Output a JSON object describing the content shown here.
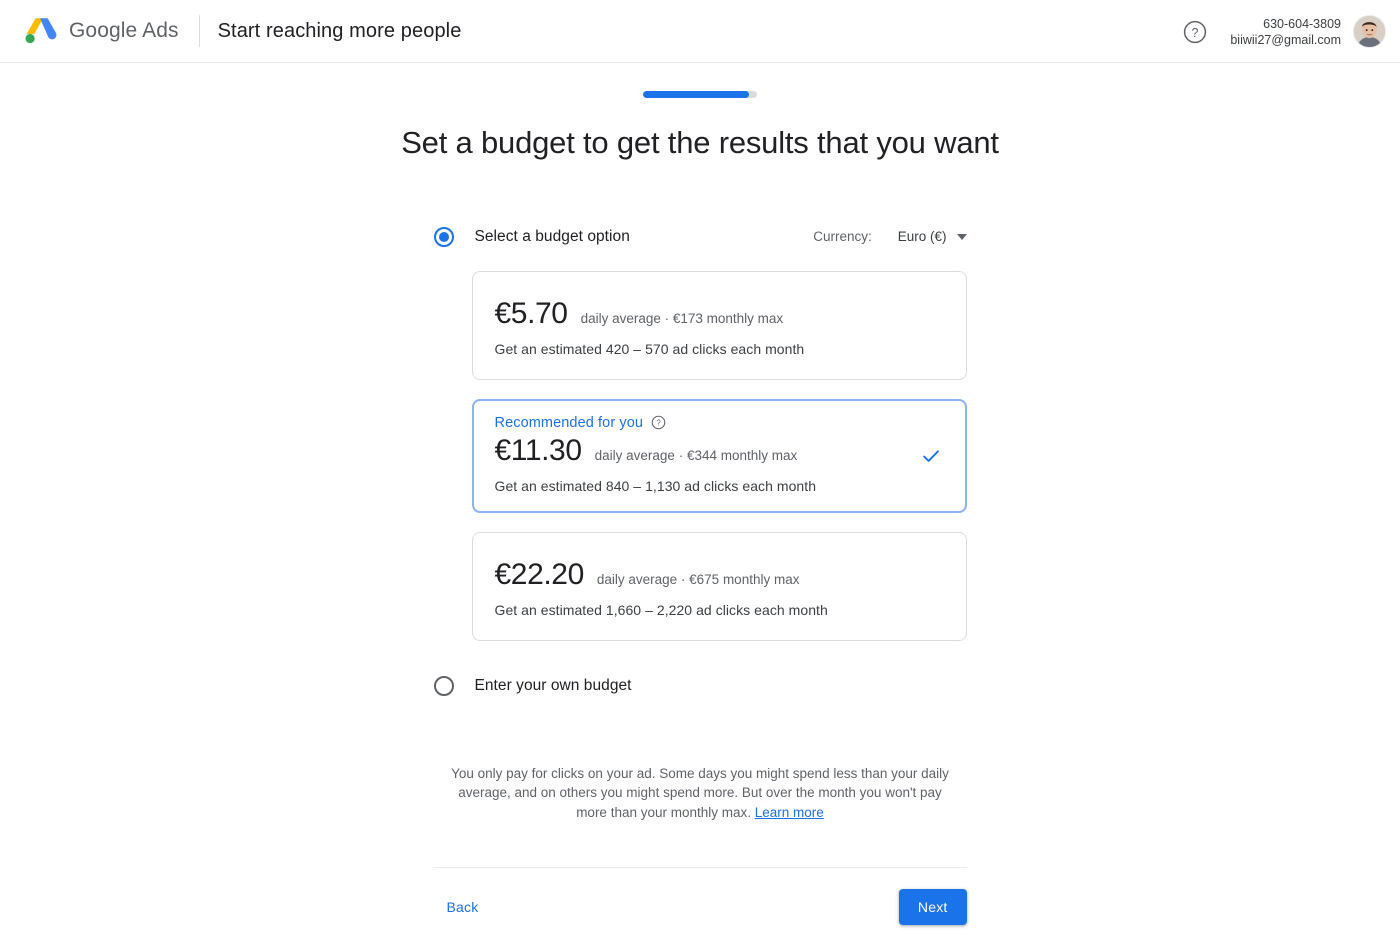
{
  "header": {
    "logo_icon": "google-ads-logo",
    "brand_name": "Google Ads",
    "page_subtitle": "Start reaching more people",
    "help_icon": "help-circle-icon",
    "phone": "630-604-3809",
    "email": "biiwii27@gmail.com",
    "avatar_icon": "user-avatar-photo"
  },
  "progress": {
    "percent": 93
  },
  "main": {
    "title": "Set a budget to get the results that you want"
  },
  "budget_option": {
    "select_label": "Select a budget option",
    "selected": true,
    "currency_label": "Currency:",
    "currency_value": "Euro (€)",
    "caret_icon": "chevron-down-icon"
  },
  "cards": [
    {
      "recommended": false,
      "price": "€5.70",
      "meta": "daily average ·  €173 monthly max",
      "estimate": "Get an estimated 420 – 570 ad clicks each month",
      "selected": false
    },
    {
      "recommended": true,
      "recommended_label": "Recommended for you",
      "recommended_help_icon": "help-circle-icon",
      "price": "€11.30",
      "meta": "daily average ·  €344 monthly max",
      "estimate": "Get an estimated 840 – 1,130 ad clicks each month",
      "selected": true,
      "check_icon": "checkmark-icon"
    },
    {
      "recommended": false,
      "price": "€22.20",
      "meta": "daily average ·  €675 monthly max",
      "estimate": "Get an estimated 1,660 – 2,220 ad clicks each month",
      "selected": false
    }
  ],
  "own_budget": {
    "label": "Enter your own budget",
    "selected": false
  },
  "disclaimer": {
    "text": "You only pay for clicks on your ad. Some days you might spend less than your daily average, and on others you might spend more. But over the month you won't pay more than your monthly max. ",
    "link_text": "Learn more"
  },
  "footer": {
    "back_label": "Back",
    "next_label": "Next"
  },
  "colors": {
    "accent_blue": "#1a73e8",
    "selected_border": "#8ab4f8",
    "text_primary": "#202124",
    "text_secondary": "#5f6368",
    "border_gray": "#dadce0"
  }
}
